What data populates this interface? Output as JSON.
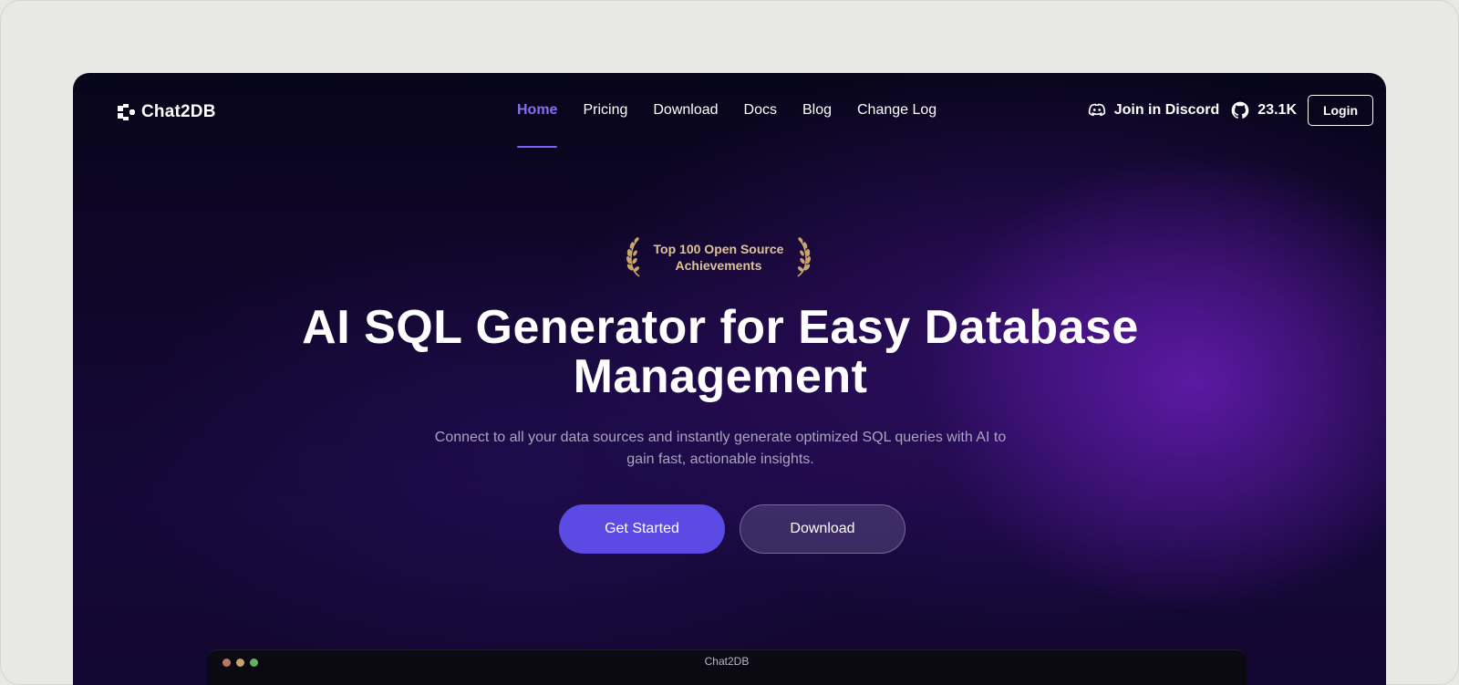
{
  "brand": {
    "name": "Chat2DB",
    "logo_icon": "chat2db-logo-icon"
  },
  "nav": {
    "items": [
      {
        "label": "Home",
        "active": true
      },
      {
        "label": "Pricing",
        "active": false
      },
      {
        "label": "Download",
        "active": false
      },
      {
        "label": "Docs",
        "active": false
      },
      {
        "label": "Blog",
        "active": false
      },
      {
        "label": "Change Log",
        "active": false
      }
    ],
    "discord_label": "Join in Discord",
    "github_stars": "23.1K",
    "login_label": "Login"
  },
  "hero": {
    "badge_line1": "Top 100 Open Source",
    "badge_line2": "Achievements",
    "headline_line1": "AI SQL Generator for Easy Database",
    "headline_line2": "Management",
    "subhead_line1": "Connect to all your data sources and instantly generate optimized SQL queries with AI to",
    "subhead_line2": "gain fast, actionable insights.",
    "primary_cta": "Get Started",
    "secondary_cta": "Download"
  },
  "preview": {
    "title": "Chat2DB"
  },
  "colors": {
    "accent": "#5b4ae3",
    "active_nav": "#8b6cf4",
    "badge_gold": "#e0c393"
  }
}
